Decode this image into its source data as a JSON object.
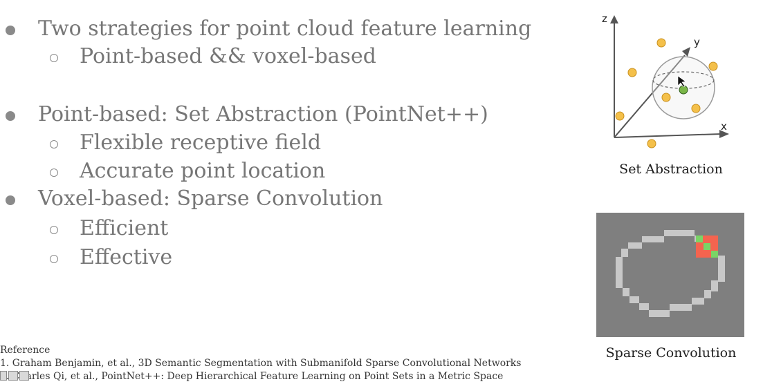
{
  "bullets": [
    {
      "level": 1,
      "text": "Two strategies for point cloud feature learning"
    },
    {
      "level": 2,
      "text": "Point-based && voxel-based"
    },
    {
      "level": 1,
      "text": "Point-based: Set Abstraction (PointNet++)"
    },
    {
      "level": 2,
      "text": "Flexible receptive field"
    },
    {
      "level": 2,
      "text": "Accurate point location"
    },
    {
      "level": 1,
      "text": "Voxel-based: Sparse Convolution"
    },
    {
      "level": 2,
      "text": "Efficient"
    },
    {
      "level": 2,
      "text": "Effective"
    }
  ],
  "figure_set_abstraction": {
    "axis_z": "z",
    "axis_y": "y",
    "axis_x": "x",
    "caption": "Set Abstraction",
    "point_color": "#f4c04a",
    "center_color": "#7ab648"
  },
  "figure_sparse_conv": {
    "caption": "Sparse Convolution",
    "background_color": "#7f7f7f",
    "cell_color": "#c8c8c8",
    "active_red": "#f4644f",
    "active_green": "#7ad466"
  },
  "reference": {
    "heading": "Reference",
    "items": [
      "1. Graham Benjamin, et al., 3D Semantic Segmentation with Submanifold Sparse Convolutional Networks",
      "2. Charles Qi, et al., PointNet++: Deep Hierarchical Feature Learning on Point Sets in a Metric Space"
    ]
  }
}
